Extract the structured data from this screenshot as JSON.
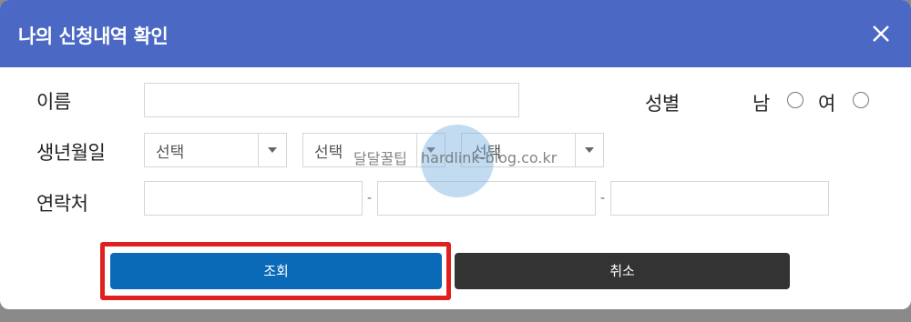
{
  "dialog": {
    "title": "나의 신청내역 확인"
  },
  "form": {
    "name_label": "이름",
    "name_value": "",
    "gender_label": "성별",
    "gender_options": [
      "남",
      "여"
    ],
    "birth_label": "생년월일",
    "birth_selects": [
      "선택",
      "선택",
      "선택"
    ],
    "phone_label": "연락처",
    "phone_sep": "-"
  },
  "buttons": {
    "search": "조회",
    "cancel": "취소"
  },
  "watermark": {
    "text_ko": "달달꿀팁",
    "text_url": "hardlink-blog.co.kr"
  },
  "colors": {
    "header": "#4b68c4",
    "search_button": "#0a6ab8",
    "cancel_button": "#333333",
    "highlight": "#e02020"
  }
}
